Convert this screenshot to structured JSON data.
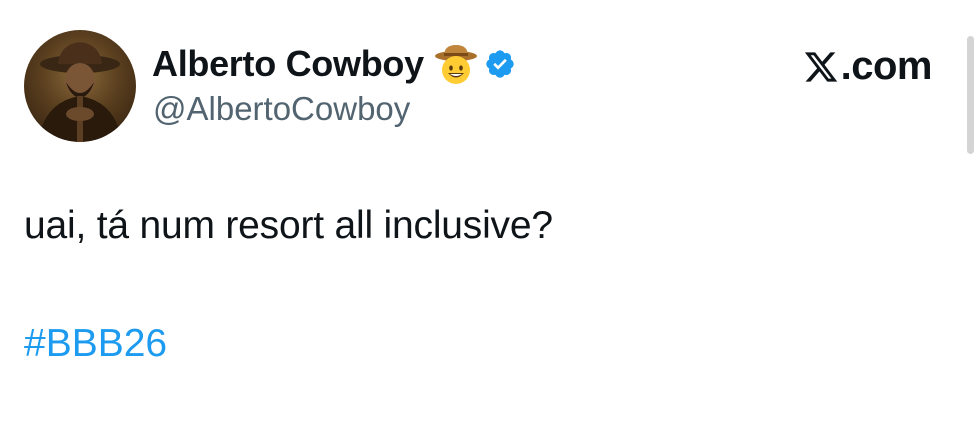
{
  "tweet": {
    "author": {
      "display_name": "Alberto Cowboy",
      "name_emoji": "cowboy-face-emoji",
      "handle": "@AlbertoCowboy",
      "verified": true,
      "verified_color": "#1d9bf0",
      "avatar": "cowboy-portrait"
    },
    "text": "uai, tá num resort all inclusive?",
    "hashtag": "#BBB26",
    "hashtag_color": "#1d9bf0"
  },
  "brand": {
    "logo_icon": "x-logo-icon",
    "text": ".com"
  },
  "colors": {
    "text_primary": "#0f1419",
    "text_secondary": "#536471",
    "background": "#ffffff"
  }
}
